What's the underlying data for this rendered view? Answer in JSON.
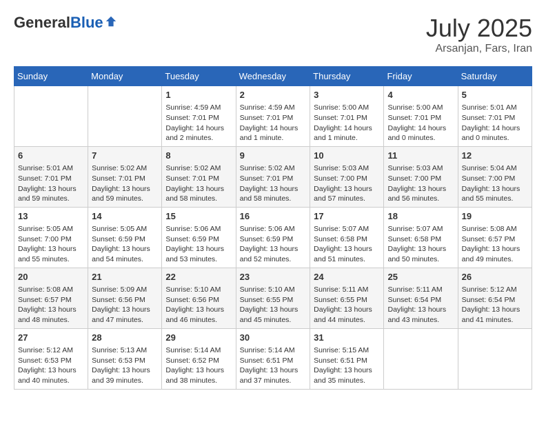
{
  "header": {
    "logo_general": "General",
    "logo_blue": "Blue",
    "title": "July 2025",
    "location": "Arsanjan, Fars, Iran"
  },
  "days_of_week": [
    "Sunday",
    "Monday",
    "Tuesday",
    "Wednesday",
    "Thursday",
    "Friday",
    "Saturday"
  ],
  "weeks": [
    [
      {
        "day": "",
        "info": ""
      },
      {
        "day": "",
        "info": ""
      },
      {
        "day": "1",
        "info": "Sunrise: 4:59 AM\nSunset: 7:01 PM\nDaylight: 14 hours and 2 minutes."
      },
      {
        "day": "2",
        "info": "Sunrise: 4:59 AM\nSunset: 7:01 PM\nDaylight: 14 hours and 1 minute."
      },
      {
        "day": "3",
        "info": "Sunrise: 5:00 AM\nSunset: 7:01 PM\nDaylight: 14 hours and 1 minute."
      },
      {
        "day": "4",
        "info": "Sunrise: 5:00 AM\nSunset: 7:01 PM\nDaylight: 14 hours and 0 minutes."
      },
      {
        "day": "5",
        "info": "Sunrise: 5:01 AM\nSunset: 7:01 PM\nDaylight: 14 hours and 0 minutes."
      }
    ],
    [
      {
        "day": "6",
        "info": "Sunrise: 5:01 AM\nSunset: 7:01 PM\nDaylight: 13 hours and 59 minutes."
      },
      {
        "day": "7",
        "info": "Sunrise: 5:02 AM\nSunset: 7:01 PM\nDaylight: 13 hours and 59 minutes."
      },
      {
        "day": "8",
        "info": "Sunrise: 5:02 AM\nSunset: 7:01 PM\nDaylight: 13 hours and 58 minutes."
      },
      {
        "day": "9",
        "info": "Sunrise: 5:02 AM\nSunset: 7:01 PM\nDaylight: 13 hours and 58 minutes."
      },
      {
        "day": "10",
        "info": "Sunrise: 5:03 AM\nSunset: 7:00 PM\nDaylight: 13 hours and 57 minutes."
      },
      {
        "day": "11",
        "info": "Sunrise: 5:03 AM\nSunset: 7:00 PM\nDaylight: 13 hours and 56 minutes."
      },
      {
        "day": "12",
        "info": "Sunrise: 5:04 AM\nSunset: 7:00 PM\nDaylight: 13 hours and 55 minutes."
      }
    ],
    [
      {
        "day": "13",
        "info": "Sunrise: 5:05 AM\nSunset: 7:00 PM\nDaylight: 13 hours and 55 minutes."
      },
      {
        "day": "14",
        "info": "Sunrise: 5:05 AM\nSunset: 6:59 PM\nDaylight: 13 hours and 54 minutes."
      },
      {
        "day": "15",
        "info": "Sunrise: 5:06 AM\nSunset: 6:59 PM\nDaylight: 13 hours and 53 minutes."
      },
      {
        "day": "16",
        "info": "Sunrise: 5:06 AM\nSunset: 6:59 PM\nDaylight: 13 hours and 52 minutes."
      },
      {
        "day": "17",
        "info": "Sunrise: 5:07 AM\nSunset: 6:58 PM\nDaylight: 13 hours and 51 minutes."
      },
      {
        "day": "18",
        "info": "Sunrise: 5:07 AM\nSunset: 6:58 PM\nDaylight: 13 hours and 50 minutes."
      },
      {
        "day": "19",
        "info": "Sunrise: 5:08 AM\nSunset: 6:57 PM\nDaylight: 13 hours and 49 minutes."
      }
    ],
    [
      {
        "day": "20",
        "info": "Sunrise: 5:08 AM\nSunset: 6:57 PM\nDaylight: 13 hours and 48 minutes."
      },
      {
        "day": "21",
        "info": "Sunrise: 5:09 AM\nSunset: 6:56 PM\nDaylight: 13 hours and 47 minutes."
      },
      {
        "day": "22",
        "info": "Sunrise: 5:10 AM\nSunset: 6:56 PM\nDaylight: 13 hours and 46 minutes."
      },
      {
        "day": "23",
        "info": "Sunrise: 5:10 AM\nSunset: 6:55 PM\nDaylight: 13 hours and 45 minutes."
      },
      {
        "day": "24",
        "info": "Sunrise: 5:11 AM\nSunset: 6:55 PM\nDaylight: 13 hours and 44 minutes."
      },
      {
        "day": "25",
        "info": "Sunrise: 5:11 AM\nSunset: 6:54 PM\nDaylight: 13 hours and 43 minutes."
      },
      {
        "day": "26",
        "info": "Sunrise: 5:12 AM\nSunset: 6:54 PM\nDaylight: 13 hours and 41 minutes."
      }
    ],
    [
      {
        "day": "27",
        "info": "Sunrise: 5:12 AM\nSunset: 6:53 PM\nDaylight: 13 hours and 40 minutes."
      },
      {
        "day": "28",
        "info": "Sunrise: 5:13 AM\nSunset: 6:53 PM\nDaylight: 13 hours and 39 minutes."
      },
      {
        "day": "29",
        "info": "Sunrise: 5:14 AM\nSunset: 6:52 PM\nDaylight: 13 hours and 38 minutes."
      },
      {
        "day": "30",
        "info": "Sunrise: 5:14 AM\nSunset: 6:51 PM\nDaylight: 13 hours and 37 minutes."
      },
      {
        "day": "31",
        "info": "Sunrise: 5:15 AM\nSunset: 6:51 PM\nDaylight: 13 hours and 35 minutes."
      },
      {
        "day": "",
        "info": ""
      },
      {
        "day": "",
        "info": ""
      }
    ]
  ]
}
